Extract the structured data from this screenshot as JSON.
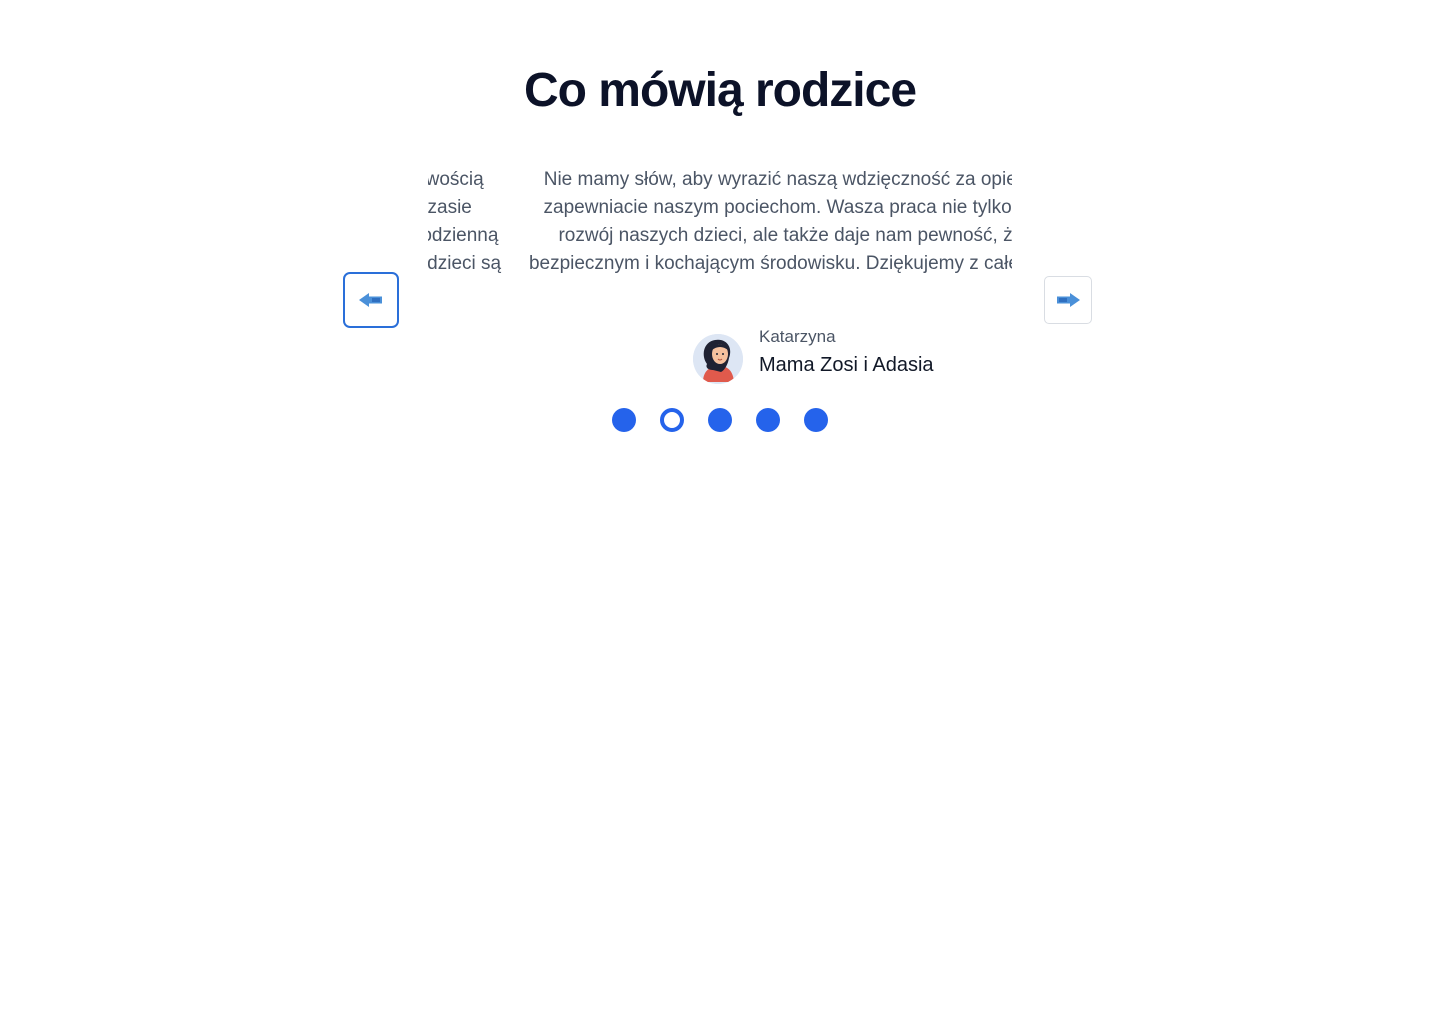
{
  "section": {
    "title": "Co mówią rodzice"
  },
  "testimonials": {
    "previous_partial": "Jesteśmy zachwyceni zaangażowaniem i cierpliwością kadry. Nasz syn zrobił niesamowitą postęp w czasie krótszym niż się spodziewaliśmy i widzimy jego codzienną radość. Jesteśmy wdzięczni za wszystko – nasze dzieci są szczęśliwe!",
    "current": "Nie mamy słów, aby wyrazić naszą wdzięczność za opiekę, jaką zapewniacie naszym pociechom. Wasza praca nie tylko wspiera rozwój naszych dzieci, ale także daje nam pewność, że są w bezpiecznym i kochającym środowisku. Dziękujemy z całego serca!",
    "author_name": "Katarzyna",
    "author_role": "Mama Zosi i Adasia",
    "avatar_icon": "woman-avatar-icon"
  },
  "navigation": {
    "prev_icon": "arrow-left-icon",
    "next_icon": "arrow-right-icon",
    "accent_color": "#2563eb"
  },
  "pagination": {
    "total": 5,
    "active_index": 1
  }
}
